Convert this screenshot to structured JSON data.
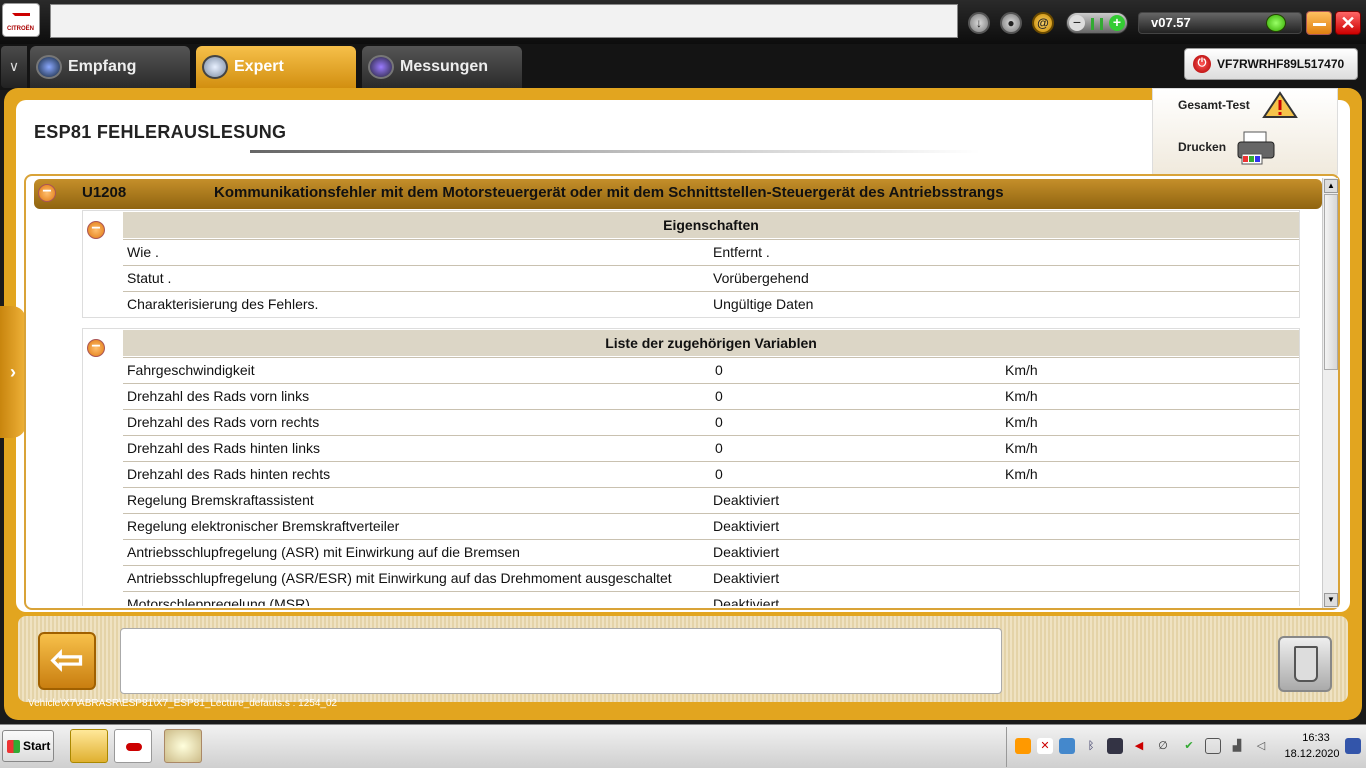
{
  "header": {
    "logo_text": "CITROËN",
    "url_value": "",
    "version": "v07.57",
    "vin": "VF7RWRHF89L517470"
  },
  "tabs": [
    {
      "label": "Empfang"
    },
    {
      "label": "Expert"
    },
    {
      "label": "Messungen"
    }
  ],
  "page": {
    "title": "ESP81  FEHLERAUSLESUNG",
    "actions": {
      "gesamt": "Gesamt-Test",
      "drucken": "Drucken"
    }
  },
  "error": {
    "code": "U1208",
    "description": "Kommunikationsfehler mit dem Motorsteuergerät oder mit dem Schnittstellen-Steuergerät des Antriebsstrangs"
  },
  "properties": {
    "title": "Eigenschaften",
    "rows": [
      {
        "name": "Wie .",
        "value": "Entfernt ."
      },
      {
        "name": "Statut .",
        "value": "Vorübergehend"
      },
      {
        "name": "Charakterisierung des Fehlers.",
        "value": "Ungültige Daten"
      }
    ]
  },
  "variables": {
    "title": "Liste der zugehörigen Variablen",
    "rows": [
      {
        "name": "Fahrgeschwindigkeit",
        "value": "0",
        "unit": "Km/h"
      },
      {
        "name": "Drehzahl des Rads vorn links",
        "value": "0",
        "unit": "Km/h"
      },
      {
        "name": "Drehzahl des Rads vorn rechts",
        "value": "0",
        "unit": "Km/h"
      },
      {
        "name": "Drehzahl des Rads hinten links",
        "value": "0",
        "unit": "Km/h"
      },
      {
        "name": "Drehzahl des Rads hinten rechts",
        "value": "0",
        "unit": "Km/h"
      },
      {
        "name": "Regelung Bremskraftassistent",
        "value": "Deaktiviert",
        "unit": ""
      },
      {
        "name": "Regelung elektronischer Bremskraftverteiler",
        "value": "Deaktiviert",
        "unit": ""
      },
      {
        "name": "Antriebsschlupfregelung (ASR) mit Einwirkung auf die Bremsen",
        "value": "Deaktiviert",
        "unit": ""
      },
      {
        "name": "Antriebsschlupfregelung (ASR/ESR) mit Einwirkung auf das Drehmoment ausgeschaltet",
        "value": "Deaktiviert",
        "unit": ""
      },
      {
        "name": "Motorschleppregelung (MSR)",
        "value": "Deaktiviert",
        "unit": ""
      }
    ]
  },
  "footer": {
    "script_path": "Vehicle\\X7\\ABRASR\\ESP81\\X7_ESP81_Lecture_defauts.s : 1254_02",
    "message": ""
  },
  "taskbar": {
    "start_label": "Start",
    "time": "16:33",
    "date": "18.12.2020"
  },
  "icons": {
    "minimize": "minimize-icon",
    "close": "close-icon",
    "warning": "warning-icon",
    "printer": "printer-icon",
    "back": "back-arrow-icon",
    "trash": "recycle-bin-icon"
  },
  "colors": {
    "accent": "#e2a51f",
    "error_header": "#a87818",
    "section_header": "#dcd6c6"
  }
}
